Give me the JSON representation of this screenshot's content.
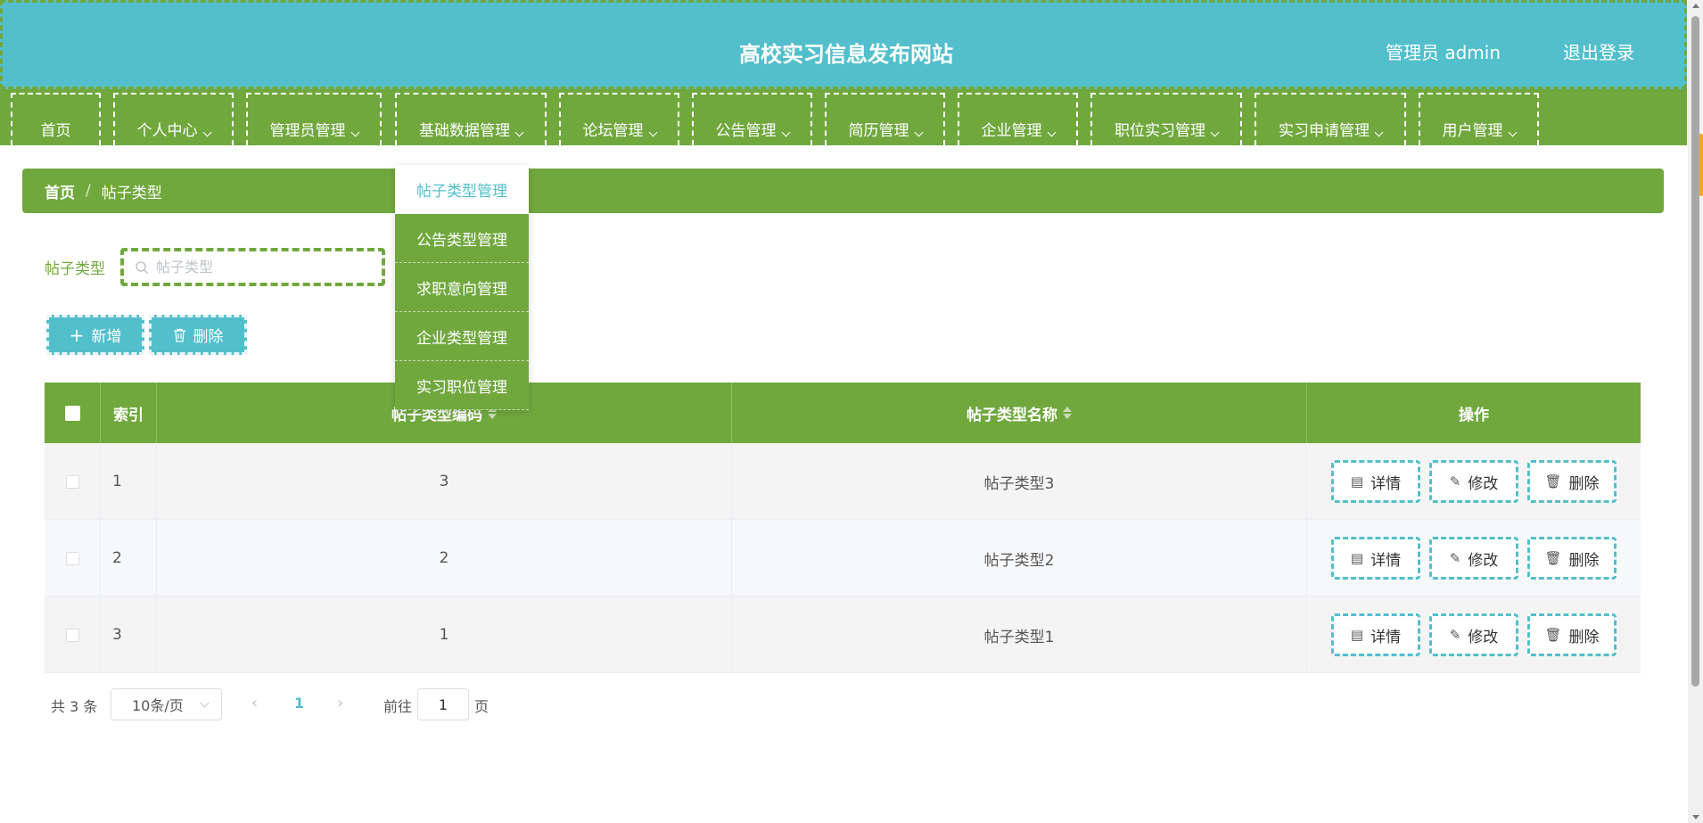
{
  "header": {
    "title": "高校实习信息发布网站",
    "admin": "管理员 admin",
    "logout": "退出登录"
  },
  "nav": {
    "items": [
      {
        "label": "首页",
        "has_dropdown": false
      },
      {
        "label": "个人中心",
        "has_dropdown": true
      },
      {
        "label": "管理员管理",
        "has_dropdown": true
      },
      {
        "label": "基础数据管理",
        "has_dropdown": true
      },
      {
        "label": "论坛管理",
        "has_dropdown": true
      },
      {
        "label": "公告管理",
        "has_dropdown": true
      },
      {
        "label": "简历管理",
        "has_dropdown": true
      },
      {
        "label": "企业管理",
        "has_dropdown": true
      },
      {
        "label": "职位实习管理",
        "has_dropdown": true
      },
      {
        "label": "实习申请管理",
        "has_dropdown": true
      },
      {
        "label": "用户管理",
        "has_dropdown": true
      }
    ]
  },
  "dropdown": {
    "items": [
      "帖子类型管理",
      "公告类型管理",
      "求职意向管理",
      "企业类型管理",
      "实习职位管理"
    ],
    "active_index": 0
  },
  "breadcrumb": {
    "home": "首页",
    "separator": "/",
    "current": "帖子类型"
  },
  "search": {
    "label": "帖子类型",
    "placeholder": "帖子类型",
    "value": ""
  },
  "toolbar": {
    "add_label": "新增",
    "delete_label": "删除"
  },
  "table": {
    "columns": [
      "索引",
      "帖子类型编码",
      "帖子类型名称",
      "操作"
    ],
    "rows": [
      {
        "index": "1",
        "code": "3",
        "name": "帖子类型3"
      },
      {
        "index": "2",
        "code": "2",
        "name": "帖子类型2"
      },
      {
        "index": "3",
        "code": "1",
        "name": "帖子类型1"
      }
    ],
    "actions": {
      "detail": "详情",
      "edit": "修改",
      "delete": "删除"
    }
  },
  "pagination": {
    "total": "共 3 条",
    "page_size": "10条/页",
    "current_page": "1",
    "goto_label": "前往",
    "goto_value": "1",
    "page_suffix": "页"
  },
  "colors": {
    "header_bg": "#53bfcc",
    "nav_bg": "#70a83e",
    "accent": "#53bfcc"
  }
}
